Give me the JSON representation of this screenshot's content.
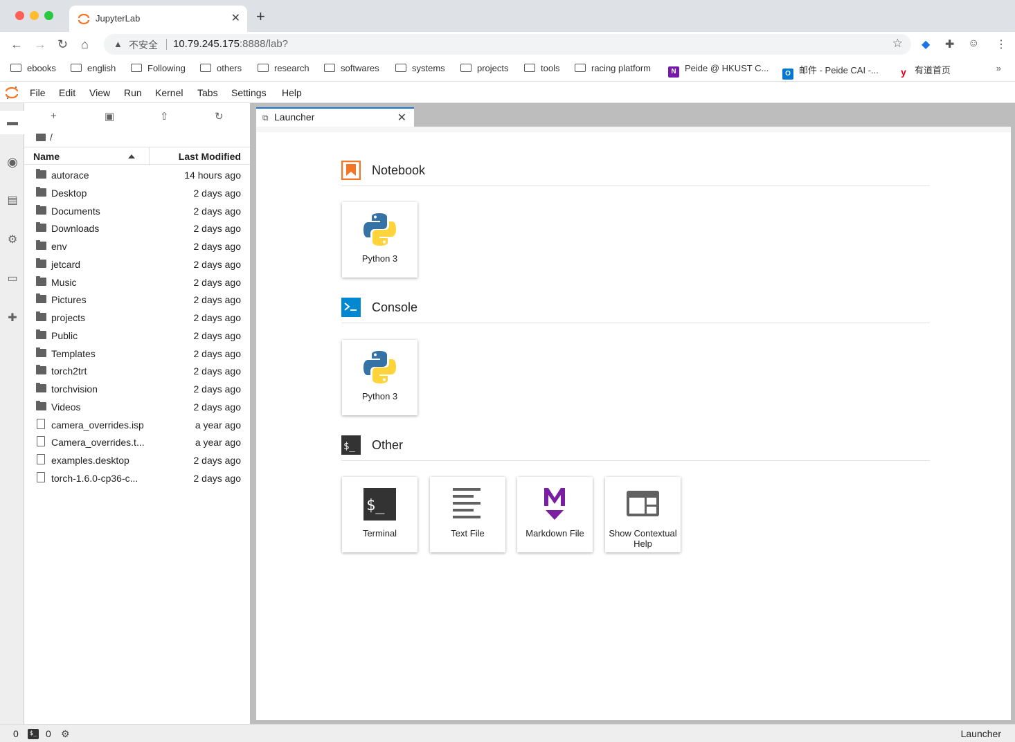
{
  "browser": {
    "tab_title": "JupyterLab",
    "insecure_label": "不安全",
    "url_host": "10.79.245.175",
    "url_rest": ":8888/lab?",
    "bookmarks": [
      "ebooks",
      "english",
      "Following",
      "others",
      "research",
      "softwares",
      "systems",
      "projects",
      "tools",
      "racing platform",
      "Peide @ HKUST C...",
      "邮件 - Peide CAI -...",
      "有道首页"
    ],
    "bookmarks_more": "»"
  },
  "menu": [
    "File",
    "Edit",
    "View",
    "Run",
    "Kernel",
    "Tabs",
    "Settings",
    "Help"
  ],
  "filebrowser": {
    "path": "/",
    "col_name": "Name",
    "col_modified": "Last Modified",
    "rows": [
      {
        "name": "autorace",
        "modified": "14 hours ago",
        "type": "folder"
      },
      {
        "name": "Desktop",
        "modified": "2 days ago",
        "type": "folder"
      },
      {
        "name": "Documents",
        "modified": "2 days ago",
        "type": "folder"
      },
      {
        "name": "Downloads",
        "modified": "2 days ago",
        "type": "folder"
      },
      {
        "name": "env",
        "modified": "2 days ago",
        "type": "folder"
      },
      {
        "name": "jetcard",
        "modified": "2 days ago",
        "type": "folder"
      },
      {
        "name": "Music",
        "modified": "2 days ago",
        "type": "folder"
      },
      {
        "name": "Pictures",
        "modified": "2 days ago",
        "type": "folder"
      },
      {
        "name": "projects",
        "modified": "2 days ago",
        "type": "folder"
      },
      {
        "name": "Public",
        "modified": "2 days ago",
        "type": "folder"
      },
      {
        "name": "Templates",
        "modified": "2 days ago",
        "type": "folder"
      },
      {
        "name": "torch2trt",
        "modified": "2 days ago",
        "type": "folder"
      },
      {
        "name": "torchvision",
        "modified": "2 days ago",
        "type": "folder"
      },
      {
        "name": "Videos",
        "modified": "2 days ago",
        "type": "folder"
      },
      {
        "name": "camera_overrides.isp",
        "modified": "a year ago",
        "type": "file"
      },
      {
        "name": "Camera_overrides.t...",
        "modified": "a year ago",
        "type": "file"
      },
      {
        "name": "examples.desktop",
        "modified": "2 days ago",
        "type": "file"
      },
      {
        "name": "torch-1.6.0-cp36-c...",
        "modified": "2 days ago",
        "type": "file"
      }
    ]
  },
  "launcher": {
    "tab_label": "Launcher",
    "sections": {
      "notebook": {
        "title": "Notebook",
        "cards": [
          "Python 3"
        ]
      },
      "console": {
        "title": "Console",
        "cards": [
          "Python 3"
        ]
      },
      "other": {
        "title": "Other",
        "cards": [
          "Terminal",
          "Text File",
          "Markdown File",
          "Show Contextual Help"
        ]
      }
    }
  },
  "status": {
    "left_count_1": "0",
    "left_count_2": "0",
    "right_label": "Launcher"
  },
  "colors": {
    "accent": "#1976d2",
    "notebook_orange": "#f37626",
    "console_blue": "#0288d1",
    "markdown_purple": "#7b1fa2"
  }
}
